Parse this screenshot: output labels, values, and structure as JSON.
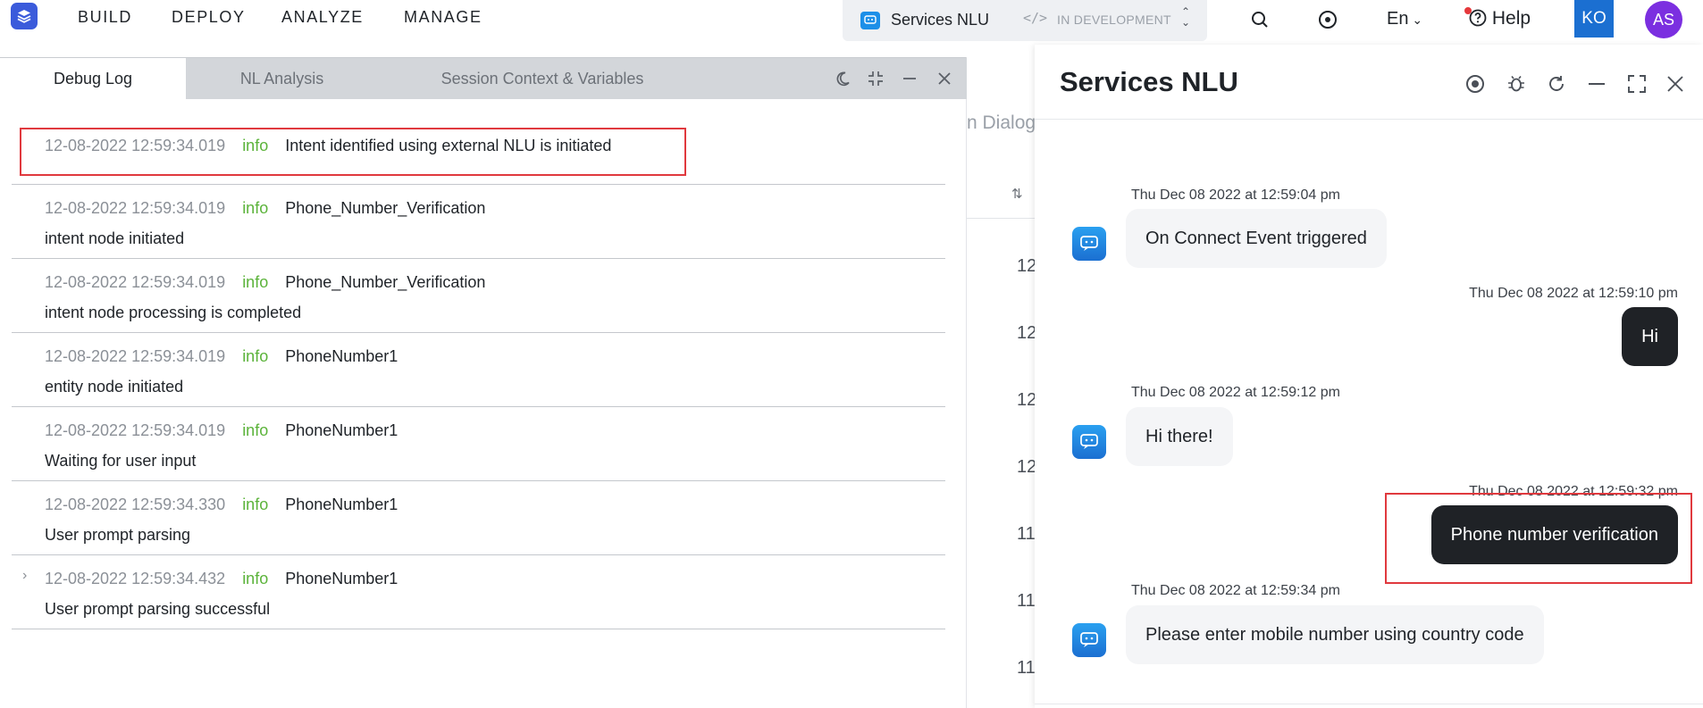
{
  "nav": {
    "links": [
      "BUILD",
      "DEPLOY",
      "ANALYZE",
      "MANAGE"
    ],
    "app_name": "Services NLU",
    "env_status": "IN DEVELOPMENT",
    "language": "En",
    "help_label": "Help",
    "user_initials_1": "KO",
    "user_initials_2": "AS",
    "colors": {
      "brand": "#3b5bdb",
      "ko_badge": "#1b6fd1",
      "as_avatar": "#7b2fe0",
      "notification": "#e5383b"
    }
  },
  "debug_panel": {
    "tabs": [
      "Debug Log",
      "NL Analysis",
      "Session Context & Variables"
    ],
    "active_tab": "Debug Log",
    "logs": [
      {
        "timestamp": "12-08-2022 12:59:34.019",
        "level": "info",
        "message": "Intent identified using external NLU is initiated",
        "detail": ""
      },
      {
        "timestamp": "12-08-2022 12:59:34.019",
        "level": "info",
        "message": "Phone_Number_Verification",
        "detail": "intent node initiated"
      },
      {
        "timestamp": "12-08-2022 12:59:34.019",
        "level": "info",
        "message": "Phone_Number_Verification",
        "detail": "intent node processing is completed"
      },
      {
        "timestamp": "12-08-2022 12:59:34.019",
        "level": "info",
        "message": "PhoneNumber1",
        "detail": "entity node initiated"
      },
      {
        "timestamp": "12-08-2022 12:59:34.019",
        "level": "info",
        "message": "PhoneNumber1",
        "detail": "Waiting for user input"
      },
      {
        "timestamp": "12-08-2022 12:59:34.330",
        "level": "info",
        "message": "PhoneNumber1",
        "detail": "User prompt parsing"
      },
      {
        "timestamp": "12-08-2022 12:59:34.432",
        "level": "info",
        "message": "PhoneNumber1",
        "detail": "User prompt parsing successful"
      }
    ],
    "colors": {
      "info_level": "#5bb33a",
      "highlight": "#e0393e"
    }
  },
  "background": {
    "dialog_label": "n Dialog",
    "rows": [
      "12",
      "12",
      "12",
      "12",
      "11",
      "11",
      "11"
    ]
  },
  "chat": {
    "title": "Services NLU",
    "messages": [
      {
        "from": "bot",
        "time": "Thu Dec 08 2022 at 12:59:04 pm",
        "text": "On Connect Event triggered"
      },
      {
        "from": "user",
        "time": "Thu Dec 08 2022 at 12:59:10 pm",
        "text": "Hi"
      },
      {
        "from": "bot",
        "time": "Thu Dec 08 2022 at 12:59:12 pm",
        "text": "Hi there!"
      },
      {
        "from": "user",
        "time": "Thu Dec 08 2022 at 12:59:32 pm",
        "text": "Phone number verification"
      },
      {
        "from": "bot",
        "time": "Thu Dec 08 2022 at 12:59:34 pm",
        "text": "Please enter mobile number using country code"
      }
    ]
  }
}
